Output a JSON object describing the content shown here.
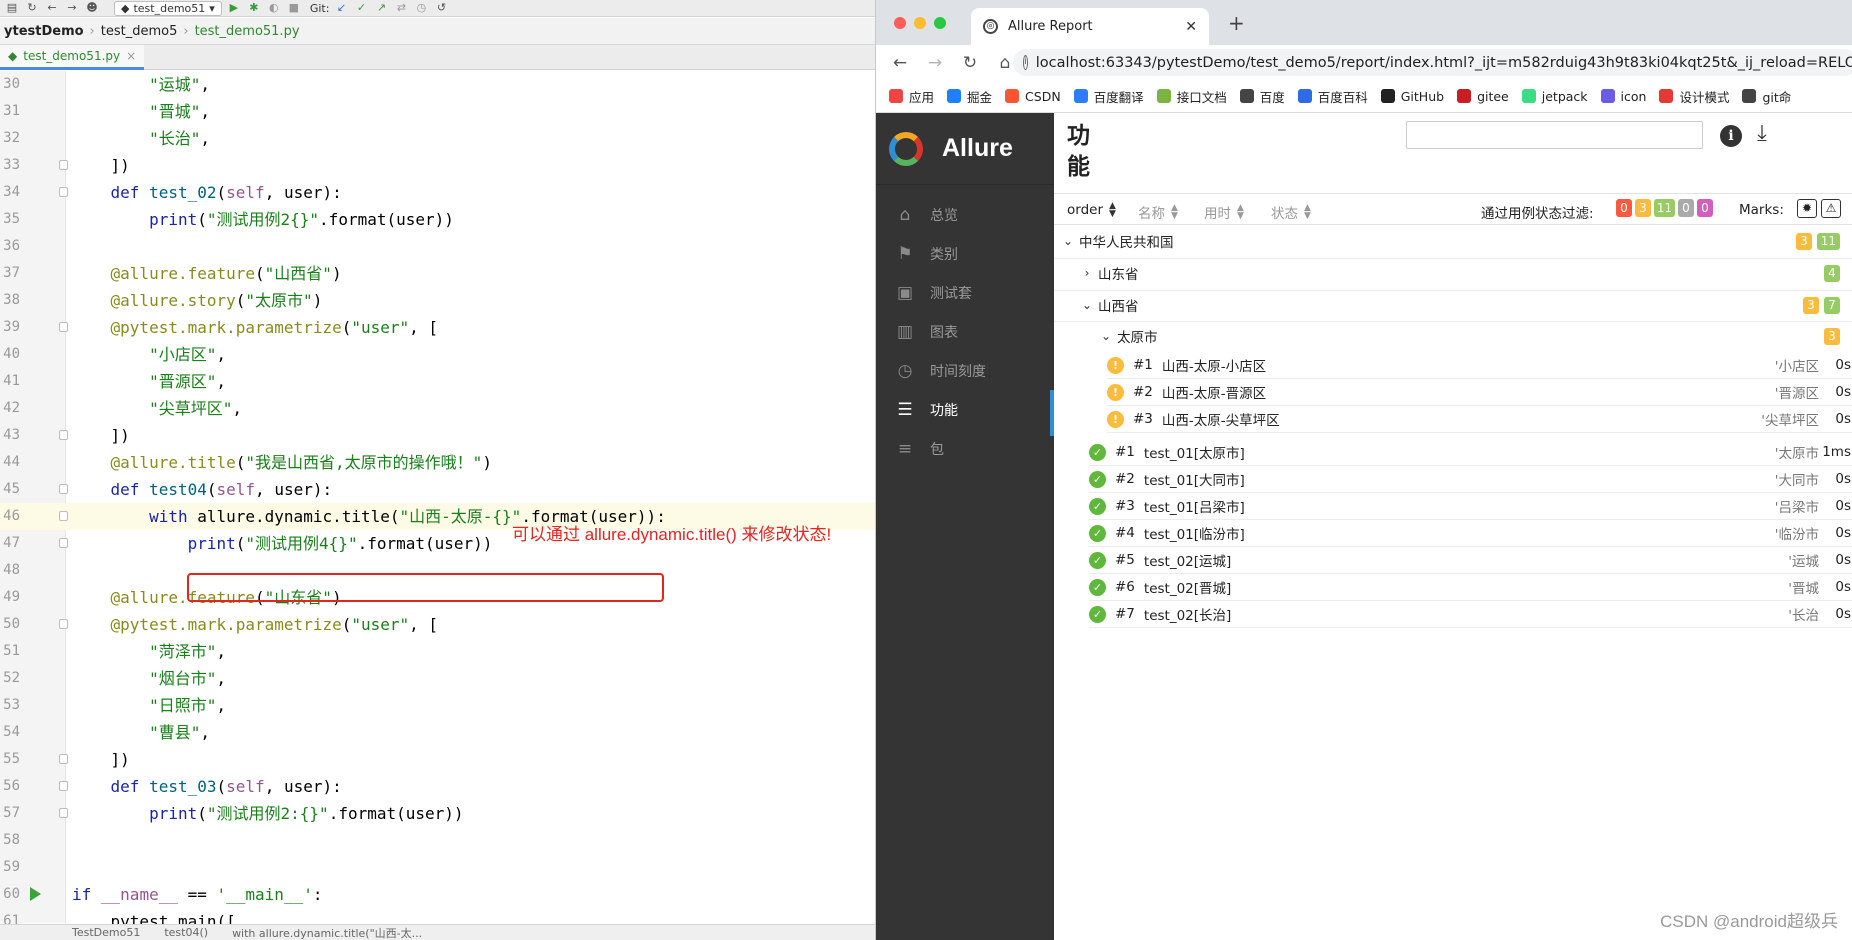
{
  "ide": {
    "run_config": "test_demo51",
    "git_label": "Git:",
    "breadcrumb": [
      "ytestDemo",
      "test_demo5",
      "test_demo51.py"
    ],
    "tab_label": "test_demo51.py",
    "annotation": "可以通过 allure.dynamic.title() 来修改状态!",
    "status_crumbs": [
      "TestDemo51",
      "test04()",
      "with allure.dynamic.title(\"山西-太..."
    ],
    "lines": [
      {
        "n": "30",
        "code": "        \"运城\","
      },
      {
        "n": "31",
        "code": "        \"晋城\","
      },
      {
        "n": "32",
        "code": "        \"长治\","
      },
      {
        "n": "33",
        "code": "    ])"
      },
      {
        "n": "34",
        "code": "    def test_02(self, user):"
      },
      {
        "n": "35",
        "code": "        print(\"测试用例2{}\".format(user))"
      },
      {
        "n": "36",
        "code": ""
      },
      {
        "n": "37",
        "code": "    @allure.feature(\"山西省\")"
      },
      {
        "n": "38",
        "code": "    @allure.story(\"太原市\")"
      },
      {
        "n": "39",
        "code": "    @pytest.mark.parametrize(\"user\", ["
      },
      {
        "n": "40",
        "code": "        \"小店区\","
      },
      {
        "n": "41",
        "code": "        \"晋源区\","
      },
      {
        "n": "42",
        "code": "        \"尖草坪区\","
      },
      {
        "n": "43",
        "code": "    ])"
      },
      {
        "n": "44",
        "code": "    @allure.title(\"我是山西省,太原市的操作哦！\")"
      },
      {
        "n": "45",
        "code": "    def test04(self, user):"
      },
      {
        "n": "46",
        "code": "        with allure.dynamic.title(\"山西-太原-{}\".format(user)):"
      },
      {
        "n": "47",
        "code": "            print(\"测试用例4{}\".format(user))"
      },
      {
        "n": "48",
        "code": ""
      },
      {
        "n": "49",
        "code": "    @allure.feature(\"山东省\")"
      },
      {
        "n": "50",
        "code": "    @pytest.mark.parametrize(\"user\", ["
      },
      {
        "n": "51",
        "code": "        \"菏泽市\","
      },
      {
        "n": "52",
        "code": "        \"烟台市\","
      },
      {
        "n": "53",
        "code": "        \"日照市\","
      },
      {
        "n": "54",
        "code": "        \"曹县\","
      },
      {
        "n": "55",
        "code": "    ])"
      },
      {
        "n": "56",
        "code": "    def test_03(self, user):"
      },
      {
        "n": "57",
        "code": "        print(\"测试用例2:{}\".format(user))"
      },
      {
        "n": "58",
        "code": ""
      },
      {
        "n": "59",
        "code": ""
      },
      {
        "n": "60",
        "code": "if __name__ == '__main__':"
      },
      {
        "n": "61",
        "code": "    pytest.main(["
      }
    ]
  },
  "browser": {
    "tab_title": "Allure Report",
    "url": "localhost:63343/pytestDemo/test_demo5/report/index.html?_ijt=m582rduig43h9t83ki04kqt25t&_ij_reload=RELOAD_ON_SAVE",
    "bookmarks": [
      {
        "label": "应用",
        "color": "#e44"
      },
      {
        "label": "掘金",
        "color": "#1e80ff"
      },
      {
        "label": "CSDN",
        "color": "#fc5531"
      },
      {
        "label": "百度翻译",
        "color": "#2e7cf6"
      },
      {
        "label": "接口文档",
        "color": "#7cb342"
      },
      {
        "label": "百度",
        "color": "#444"
      },
      {
        "label": "百度百科",
        "color": "#2e6be6"
      },
      {
        "label": "GitHub",
        "color": "#222"
      },
      {
        "label": "gitee",
        "color": "#c71d23"
      },
      {
        "label": "jetpack",
        "color": "#3ddc84"
      },
      {
        "label": "icon",
        "color": "#6b5be6"
      },
      {
        "label": "设计模式",
        "color": "#e53935"
      },
      {
        "label": "git命",
        "color": "#444"
      }
    ]
  },
  "allure": {
    "brand": "Allure",
    "nav": [
      {
        "label": "总览",
        "icon": "home-icon",
        "glyph": "⌂"
      },
      {
        "label": "类别",
        "icon": "flag-icon",
        "glyph": "⚑"
      },
      {
        "label": "测试套",
        "icon": "briefcase-icon",
        "glyph": "▣"
      },
      {
        "label": "图表",
        "icon": "bar-chart-icon",
        "glyph": "▥"
      },
      {
        "label": "时间刻度",
        "icon": "clock-icon",
        "glyph": "◷"
      },
      {
        "label": "功能",
        "icon": "list-icon",
        "glyph": "☰"
      },
      {
        "label": "包",
        "icon": "align-left-icon",
        "glyph": "≡"
      }
    ],
    "page_title": "功能",
    "sort": {
      "order": "order",
      "name": "名称",
      "duration": "用时",
      "status": "状态"
    },
    "filter_label": "通过用例状态过滤:",
    "filter_counts": [
      {
        "value": "0",
        "status": "failed"
      },
      {
        "value": "3",
        "status": "broken"
      },
      {
        "value": "11",
        "status": "passed"
      },
      {
        "value": "0",
        "status": "skipped"
      },
      {
        "value": "0",
        "status": "unknown"
      }
    ],
    "marks_label": "Marks:",
    "tree": {
      "root": {
        "label": "中华人民共和国",
        "broken": "3",
        "passed": "11"
      },
      "shandong": {
        "label": "山东省",
        "passed": "4"
      },
      "shanxi": {
        "label": "山西省",
        "broken": "3",
        "passed": "7"
      },
      "taiyuan": {
        "label": "太原市",
        "broken": "3"
      }
    },
    "broken_cases": [
      {
        "num": "#1",
        "name": "山西-太原-小店区",
        "param": "'小店区",
        "dur": "0s"
      },
      {
        "num": "#2",
        "name": "山西-太原-晋源区",
        "param": "'晋源区",
        "dur": "0s"
      },
      {
        "num": "#3",
        "name": "山西-太原-尖草坪区",
        "param": "'尖草坪区",
        "dur": "0s"
      }
    ],
    "passed_cases": [
      {
        "num": "#1",
        "name": "test_01[太原市]",
        "param": "'太原市",
        "dur": "1ms"
      },
      {
        "num": "#2",
        "name": "test_01[大同市]",
        "param": "'大同市",
        "dur": "0s"
      },
      {
        "num": "#3",
        "name": "test_01[吕梁市]",
        "param": "'吕梁市",
        "dur": "0s"
      },
      {
        "num": "#4",
        "name": "test_01[临汾市]",
        "param": "'临汾市",
        "dur": "0s"
      },
      {
        "num": "#5",
        "name": "test_02[运城]",
        "param": "'运城",
        "dur": "0s"
      },
      {
        "num": "#6",
        "name": "test_02[晋城]",
        "param": "'晋城",
        "dur": "0s"
      },
      {
        "num": "#7",
        "name": "test_02[长治]",
        "param": "'长治",
        "dur": "0s"
      }
    ]
  },
  "watermark": "CSDN @android超级兵"
}
